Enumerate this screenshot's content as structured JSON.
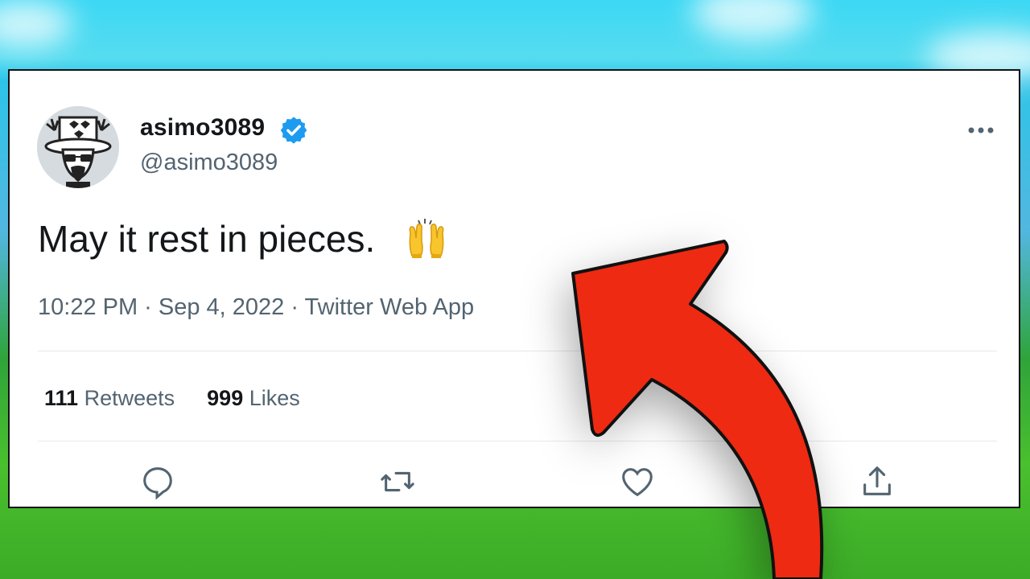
{
  "tweet": {
    "display_name": "asimo3089",
    "handle": "@asimo3089",
    "text": "May it rest in pieces.",
    "emoji_icon": "raising-hands-emoji",
    "meta": "10:22 PM · Sep 4, 2022 · Twitter Web App",
    "retweets_count": "111",
    "retweets_label": "Retweets",
    "likes_count": "999",
    "likes_label": "Likes"
  },
  "icons": {
    "verified": "verified-badge-icon",
    "more": "more-options-icon",
    "reply": "reply-icon",
    "retweet": "retweet-icon",
    "like": "heart-icon",
    "share": "share-icon"
  },
  "colors": {
    "verified_blue": "#1d9bf0",
    "arrow_red": "#ee2a12",
    "muted_text": "#536471"
  }
}
